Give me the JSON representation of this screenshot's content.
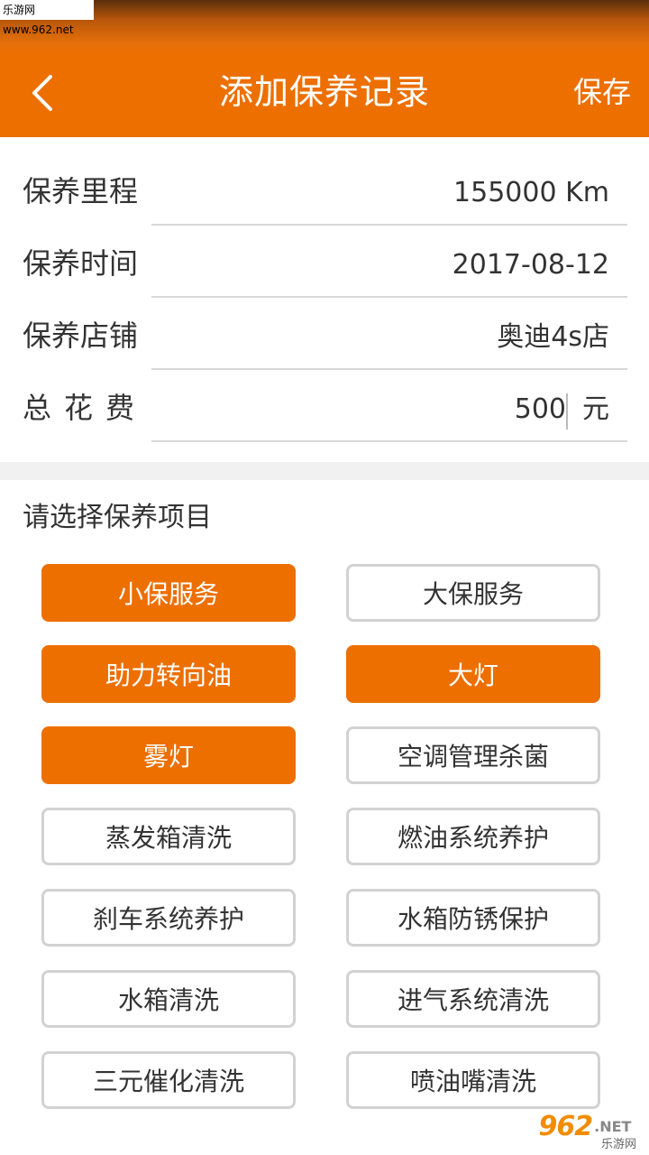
{
  "watermark": {
    "top_text": "乐游网 www.962.net",
    "bottom_number": "962",
    "bottom_suffix": ".NET",
    "bottom_sub": "乐游网"
  },
  "header": {
    "title": "添加保养记录",
    "save_label": "保存",
    "back_icon": "chevron-left-icon",
    "background_color": "#ec6f00"
  },
  "form": {
    "mileage": {
      "label": "保养里程",
      "value": "155000  Km"
    },
    "date": {
      "label": "保养时间",
      "value": "2017-08-12"
    },
    "shop": {
      "label": "保养店铺",
      "value": "奥迪4s店"
    },
    "cost": {
      "label": "总花费",
      "value": "500",
      "unit": "元"
    }
  },
  "items_section": {
    "title": "请选择保养项目",
    "items": [
      {
        "label": "小保服务",
        "selected": true
      },
      {
        "label": "大保服务",
        "selected": false
      },
      {
        "label": "助力转向油",
        "selected": true
      },
      {
        "label": "大灯",
        "selected": true
      },
      {
        "label": "雾灯",
        "selected": true
      },
      {
        "label": "空调管理杀菌",
        "selected": false
      },
      {
        "label": "蒸发箱清洗",
        "selected": false
      },
      {
        "label": "燃油系统养护",
        "selected": false
      },
      {
        "label": "刹车系统养护",
        "selected": false
      },
      {
        "label": "水箱防锈保护",
        "selected": false
      },
      {
        "label": "水箱清洗",
        "selected": false
      },
      {
        "label": "进气系统清洗",
        "selected": false
      },
      {
        "label": "三元催化清洗",
        "selected": false
      },
      {
        "label": "喷油嘴清洗",
        "selected": false
      }
    ]
  },
  "colors": {
    "accent": "#ec6f00",
    "chip_border": "#d2d2d2",
    "text": "#333333"
  }
}
